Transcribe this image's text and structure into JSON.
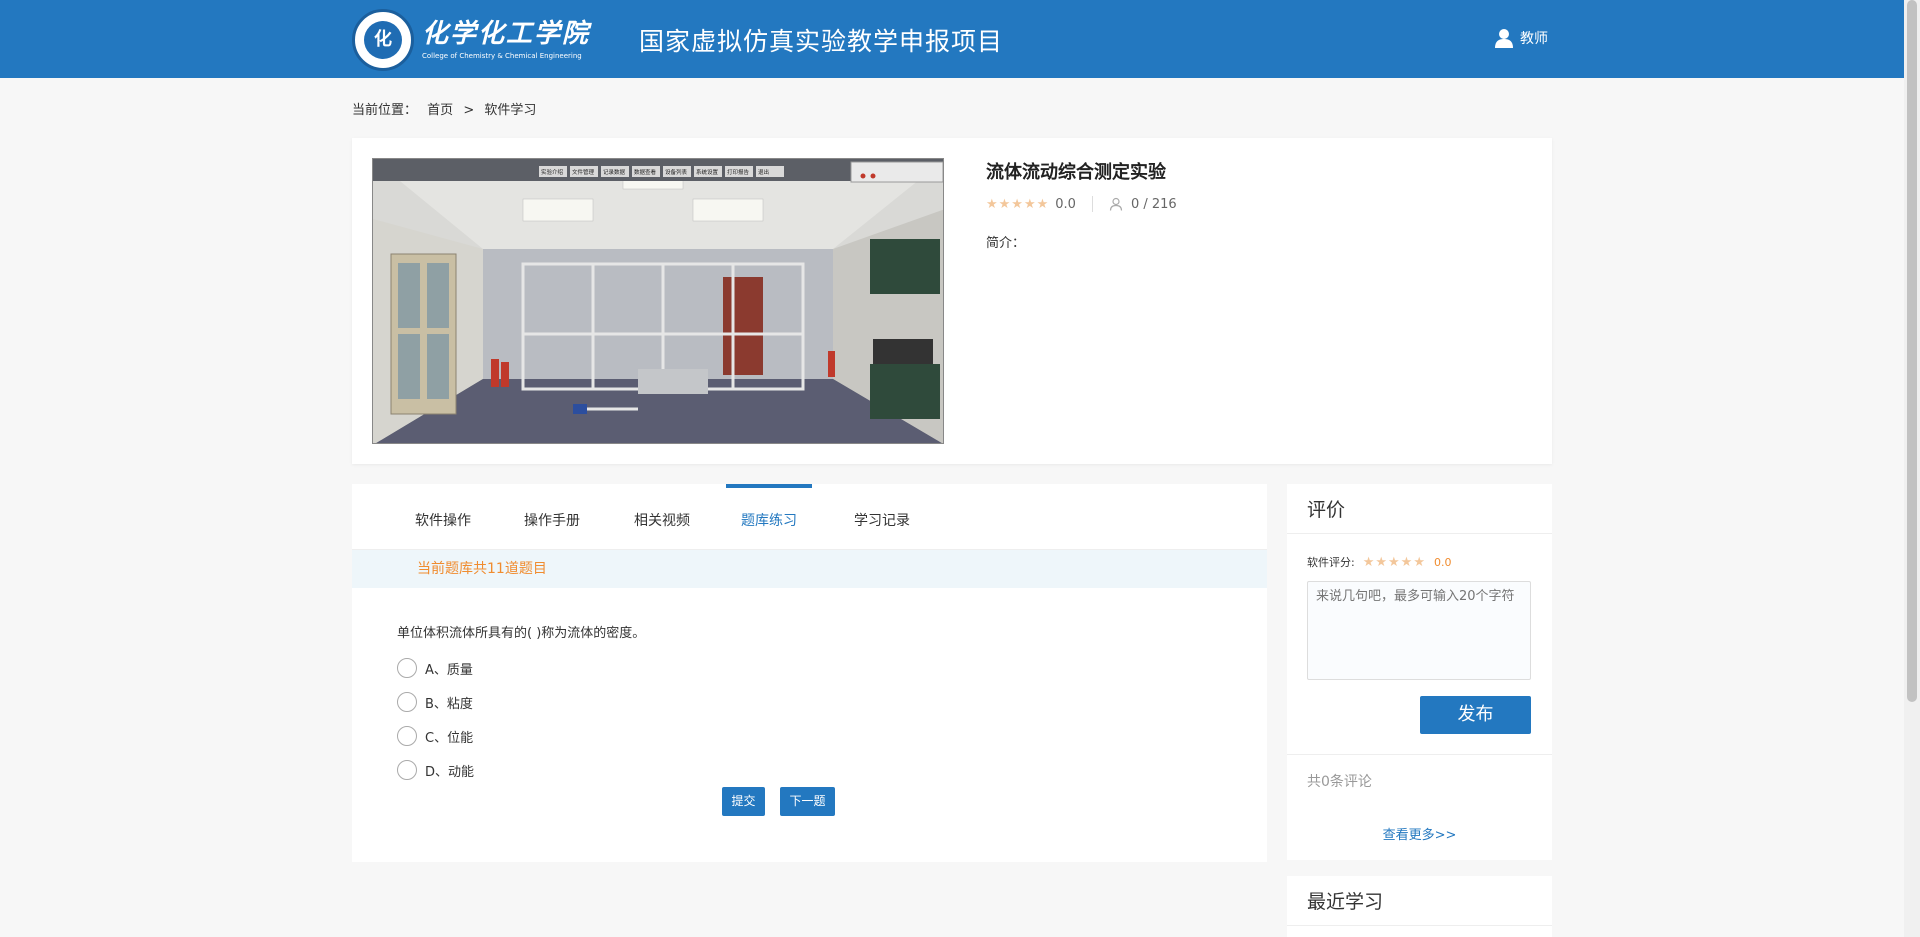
{
  "header": {
    "logo_seal_text": "化",
    "logo_name": "化学化工学院",
    "logo_subtitle": "College of Chemistry & Chemical Engineering",
    "site_title": "国家虚拟仿真实验教学申报项目",
    "user_label": "教师"
  },
  "breadcrumb": {
    "prefix": "当前位置：",
    "home": "首页",
    "separator": ">",
    "current": "软件学习"
  },
  "course": {
    "title": "流体流动综合测定实验",
    "rating": "0.0",
    "users": "0 / 216",
    "intro_label": "简介："
  },
  "screenshot_menu": [
    "实验介绍",
    "文件管理",
    "记录数据",
    "数据查看",
    "设备列表",
    "系统设置",
    "打印报告",
    "退出"
  ],
  "tabs": [
    {
      "label": "软件操作"
    },
    {
      "label": "操作手册"
    },
    {
      "label": "相关视频"
    },
    {
      "label": "题库练习"
    },
    {
      "label": "学习记录"
    }
  ],
  "quiz": {
    "notice": "当前题库共11道题目",
    "question": "单位体积流体所具有的( )称为流体的密度。",
    "options": [
      "A、质量",
      "B、粘度",
      "C、位能",
      "D、动能"
    ],
    "submit_label": "提交",
    "next_label": "下一题"
  },
  "comments": {
    "title": "评价",
    "score_label": "软件评分:",
    "score_value": "0.0",
    "placeholder": "来说几句吧，最多可输入20个字符",
    "publish_label": "发布",
    "count_text": "共0条评论",
    "more_label": "查看更多>>"
  },
  "recent": {
    "title": "最近学习"
  },
  "colors": {
    "primary": "#2378c0",
    "accent_orange": "#f08c2f",
    "star": "#f3c79b",
    "notice_bg": "#eef6fa"
  }
}
